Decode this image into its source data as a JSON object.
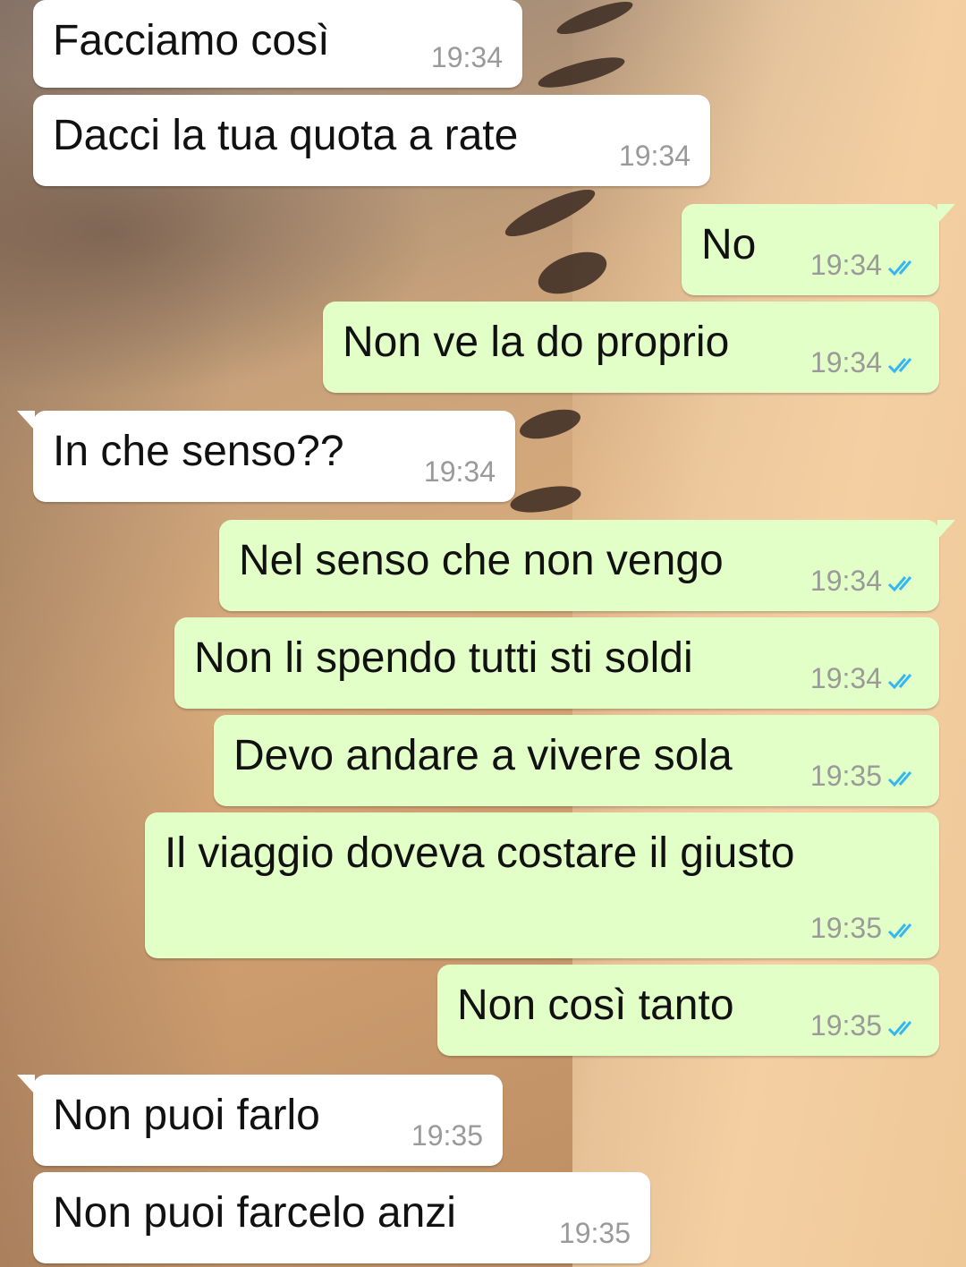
{
  "messages": [
    {
      "dir": "in",
      "text": "Facciamo così",
      "time": "19:34",
      "read": false
    },
    {
      "dir": "in",
      "text": "Dacci la tua quota a rate",
      "time": "19:34",
      "read": false
    },
    {
      "dir": "out",
      "text": "No",
      "time": "19:34",
      "read": true
    },
    {
      "dir": "out",
      "text": "Non ve la do proprio",
      "time": "19:34",
      "read": true
    },
    {
      "dir": "in",
      "text": "In che senso??",
      "time": "19:34",
      "read": false
    },
    {
      "dir": "out",
      "text": "Nel senso che non vengo",
      "time": "19:34",
      "read": true
    },
    {
      "dir": "out",
      "text": "Non li spendo tutti sti soldi",
      "time": "19:34",
      "read": true
    },
    {
      "dir": "out",
      "text": "Devo andare a vivere sola",
      "time": "19:35",
      "read": true
    },
    {
      "dir": "out",
      "text": "Il viaggio doveva costare il giusto",
      "time": "19:35",
      "read": true
    },
    {
      "dir": "out",
      "text": "Non così tanto",
      "time": "19:35",
      "read": true
    },
    {
      "dir": "in",
      "text": "Non puoi farlo",
      "time": "19:35",
      "read": false
    },
    {
      "dir": "in",
      "text": "Non puoi farcelo anzi",
      "time": "19:35",
      "read": false
    }
  ],
  "colors": {
    "incoming_bubble": "#ffffff",
    "outgoing_bubble": "#e2ffc7",
    "read_tick": "#34b7f1",
    "timestamp": "#9a9a9a"
  },
  "icons": {
    "read_receipt": "double-check-icon"
  }
}
